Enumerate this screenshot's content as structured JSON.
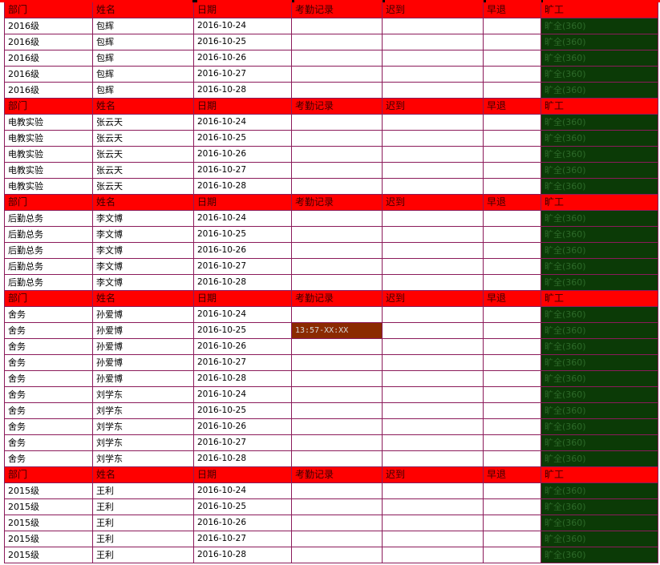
{
  "headers": {
    "dept": "部门",
    "name": "姓名",
    "date": "日期",
    "record": "考勤记录",
    "late": "迟到",
    "early": "早退",
    "absent": "旷工"
  },
  "absent_text": "旷全(360)",
  "colors": {
    "header_bg": "#ff0000",
    "absent_bg": "#0b3a06",
    "record_filled_bg": "#8b2a00",
    "grid": "#8b1a5a"
  },
  "rows": [
    {
      "type": "header"
    },
    {
      "type": "data",
      "dept": "2016级",
      "name": "包辉",
      "date": "2016-10-24",
      "record": ""
    },
    {
      "type": "data",
      "dept": "2016级",
      "name": "包辉",
      "date": "2016-10-25",
      "record": ""
    },
    {
      "type": "data",
      "dept": "2016级",
      "name": "包辉",
      "date": "2016-10-26",
      "record": ""
    },
    {
      "type": "data",
      "dept": "2016级",
      "name": "包辉",
      "date": "2016-10-27",
      "record": ""
    },
    {
      "type": "data",
      "dept": "2016级",
      "name": "包辉",
      "date": "2016-10-28",
      "record": ""
    },
    {
      "type": "header"
    },
    {
      "type": "data",
      "dept": "电教实验",
      "name": "张云天",
      "date": "2016-10-24",
      "record": ""
    },
    {
      "type": "data",
      "dept": "电教实验",
      "name": "张云天",
      "date": "2016-10-25",
      "record": ""
    },
    {
      "type": "data",
      "dept": "电教实验",
      "name": "张云天",
      "date": "2016-10-26",
      "record": ""
    },
    {
      "type": "data",
      "dept": "电教实验",
      "name": "张云天",
      "date": "2016-10-27",
      "record": ""
    },
    {
      "type": "data",
      "dept": "电教实验",
      "name": "张云天",
      "date": "2016-10-28",
      "record": ""
    },
    {
      "type": "header"
    },
    {
      "type": "data",
      "dept": "后勤总务",
      "name": "李文博",
      "date": "2016-10-24",
      "record": ""
    },
    {
      "type": "data",
      "dept": "后勤总务",
      "name": "李文博",
      "date": "2016-10-25",
      "record": ""
    },
    {
      "type": "data",
      "dept": "后勤总务",
      "name": "李文博",
      "date": "2016-10-26",
      "record": ""
    },
    {
      "type": "data",
      "dept": "后勤总务",
      "name": "李文博",
      "date": "2016-10-27",
      "record": ""
    },
    {
      "type": "data",
      "dept": "后勤总务",
      "name": "李文博",
      "date": "2016-10-28",
      "record": ""
    },
    {
      "type": "header"
    },
    {
      "type": "data",
      "dept": "舍务",
      "name": "孙爱博",
      "date": "2016-10-24",
      "record": ""
    },
    {
      "type": "data",
      "dept": "舍务",
      "name": "孙爱博",
      "date": "2016-10-25",
      "record": "13:57-XX:XX"
    },
    {
      "type": "data",
      "dept": "舍务",
      "name": "孙爱博",
      "date": "2016-10-26",
      "record": ""
    },
    {
      "type": "data",
      "dept": "舍务",
      "name": "孙爱博",
      "date": "2016-10-27",
      "record": ""
    },
    {
      "type": "data",
      "dept": "舍务",
      "name": "孙爱博",
      "date": "2016-10-28",
      "record": ""
    },
    {
      "type": "data",
      "dept": "舍务",
      "name": "刘学东",
      "date": "2016-10-24",
      "record": ""
    },
    {
      "type": "data",
      "dept": "舍务",
      "name": "刘学东",
      "date": "2016-10-25",
      "record": ""
    },
    {
      "type": "data",
      "dept": "舍务",
      "name": "刘学东",
      "date": "2016-10-26",
      "record": ""
    },
    {
      "type": "data",
      "dept": "舍务",
      "name": "刘学东",
      "date": "2016-10-27",
      "record": ""
    },
    {
      "type": "data",
      "dept": "舍务",
      "name": "刘学东",
      "date": "2016-10-28",
      "record": ""
    },
    {
      "type": "header"
    },
    {
      "type": "data",
      "dept": "2015级",
      "name": "王利",
      "date": "2016-10-24",
      "record": ""
    },
    {
      "type": "data",
      "dept": "2015级",
      "name": "王利",
      "date": "2016-10-25",
      "record": ""
    },
    {
      "type": "data",
      "dept": "2015级",
      "name": "王利",
      "date": "2016-10-26",
      "record": ""
    },
    {
      "type": "data",
      "dept": "2015级",
      "name": "王利",
      "date": "2016-10-27",
      "record": ""
    },
    {
      "type": "data",
      "dept": "2015级",
      "name": "王利",
      "date": "2016-10-28",
      "record": ""
    }
  ]
}
